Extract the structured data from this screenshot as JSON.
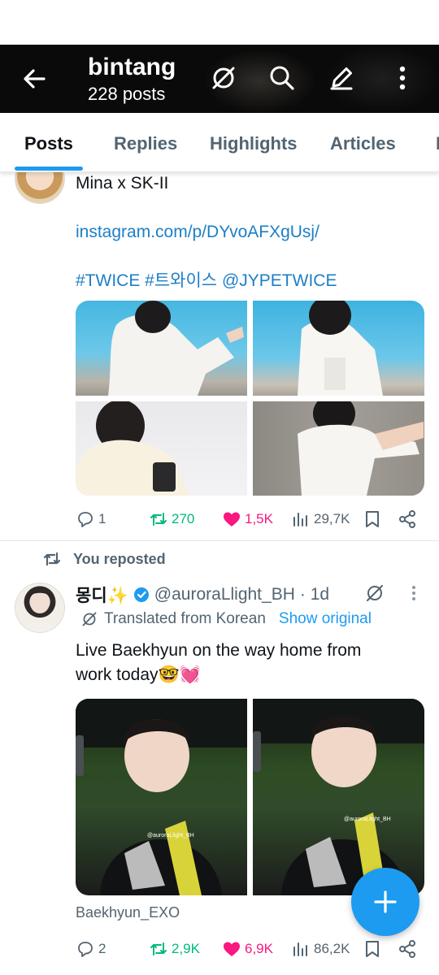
{
  "header": {
    "name": "bintang",
    "post_count": "228 posts"
  },
  "tabs": [
    {
      "label": "Posts"
    },
    {
      "label": "Replies"
    },
    {
      "label": "Highlights"
    },
    {
      "label": "Articles"
    },
    {
      "label": "M"
    }
  ],
  "post1": {
    "text_line1": "Mina x SK-II",
    "link": "instagram.com/p/DYvoAFXgUsj/",
    "hashtags": "#TWICE #트와이스 @JYPETWICE",
    "replies": "1",
    "reposts": "270",
    "likes": "1,5K",
    "views": "29,7K"
  },
  "post2": {
    "repost_label": "You reposted",
    "display_name": "몽디✨",
    "handle": "@auroraLlight_BH",
    "time": "· 1d",
    "translated_label": "Translated from Korean",
    "show_original": "Show original",
    "text_line1": "Live Baekhyun on the way home from",
    "text_line2": "work today🤓💓",
    "image_watermark": "@auroraLlight_BH",
    "caption": "Baekhyun_EXO",
    "replies": "2",
    "reposts": "2,9K",
    "likes": "6,9K",
    "views": "86,2K"
  },
  "colors": {
    "accent": "#1d9bf0",
    "repost_green": "#00ba7c",
    "like_pink": "#f91880",
    "muted": "#536471"
  }
}
